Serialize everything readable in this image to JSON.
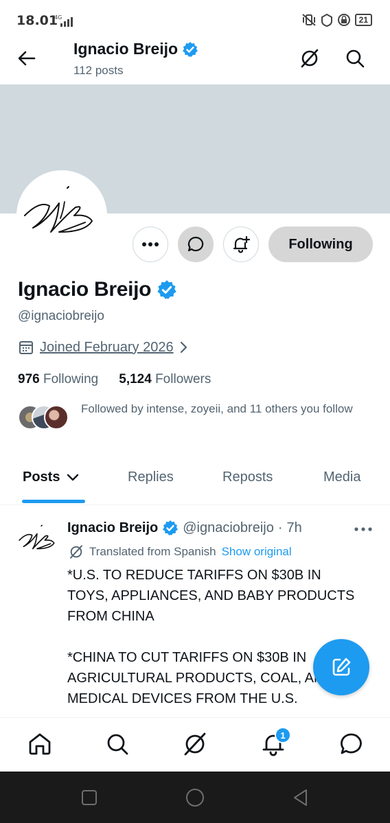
{
  "status_bar": {
    "time": "18.01",
    "network": "4G",
    "battery": "21"
  },
  "header": {
    "name": "Ignacio Breijo",
    "posts_count": "112 posts"
  },
  "profile": {
    "name": "Ignacio Breijo",
    "handle": "@ignaciobreijo",
    "joined": "Joined February 2026",
    "following_count": "976",
    "following_label": "Following",
    "followers_count": "5,124",
    "followers_label": "Followers",
    "followed_by": "Followed by intense, zoyeii, and 11 others you follow",
    "following_button": "Following"
  },
  "tabs": [
    {
      "label": "Posts"
    },
    {
      "label": "Replies"
    },
    {
      "label": "Reposts"
    },
    {
      "label": "Media"
    }
  ],
  "post": {
    "name": "Ignacio Breijo",
    "handle": "@ignaciobreijo",
    "separator": "·",
    "time": "7h",
    "translated_label": "Translated from Spanish",
    "show_original": "Show original",
    "text": "*U.S. TO REDUCE TARIFFS ON $30B IN TOYS, APPLIANCES, AND BABY PRODUCTS FROM CHINA\n\n*CHINA TO CUT TARIFFS ON $30B IN AGRICULTURAL PRODUCTS, COAL, AND MEDICAL DEVICES FROM THE U.S."
  },
  "bottom_nav": {
    "notification_badge": "1"
  },
  "colors": {
    "accent": "#1d9bf0",
    "banner": "#cfd9de",
    "muted": "#536471"
  }
}
